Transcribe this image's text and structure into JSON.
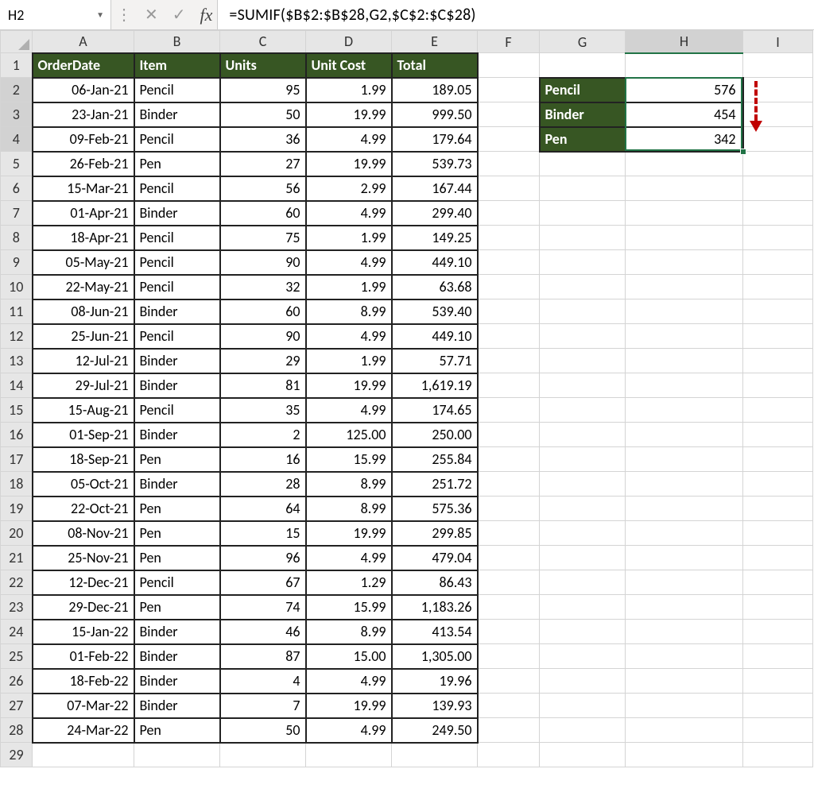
{
  "formula_bar": {
    "name_box": "H2",
    "fx_label": "fx",
    "formula": "=SUMIF($B$2:$B$28,G2,$C$2:$C$28)"
  },
  "columns": [
    "A",
    "B",
    "C",
    "D",
    "E",
    "F",
    "G",
    "H",
    "I"
  ],
  "row_headers": [
    "1",
    "2",
    "3",
    "4",
    "5",
    "6",
    "7",
    "8",
    "9",
    "10",
    "11",
    "12",
    "13",
    "14",
    "15",
    "16",
    "17",
    "18",
    "19",
    "20",
    "21",
    "22",
    "23",
    "24",
    "25",
    "26",
    "27",
    "28",
    "29"
  ],
  "main_table": {
    "headers": {
      "A": "OrderDate",
      "B": "Item",
      "C": "Units",
      "D": "Unit Cost",
      "E": "Total"
    },
    "rows": [
      {
        "A": "06-Jan-21",
        "B": "Pencil",
        "C": "95",
        "D": "1.99",
        "E": "189.05"
      },
      {
        "A": "23-Jan-21",
        "B": "Binder",
        "C": "50",
        "D": "19.99",
        "E": "999.50"
      },
      {
        "A": "09-Feb-21",
        "B": "Pencil",
        "C": "36",
        "D": "4.99",
        "E": "179.64"
      },
      {
        "A": "26-Feb-21",
        "B": "Pen",
        "C": "27",
        "D": "19.99",
        "E": "539.73"
      },
      {
        "A": "15-Mar-21",
        "B": "Pencil",
        "C": "56",
        "D": "2.99",
        "E": "167.44"
      },
      {
        "A": "01-Apr-21",
        "B": "Binder",
        "C": "60",
        "D": "4.99",
        "E": "299.40"
      },
      {
        "A": "18-Apr-21",
        "B": "Pencil",
        "C": "75",
        "D": "1.99",
        "E": "149.25"
      },
      {
        "A": "05-May-21",
        "B": "Pencil",
        "C": "90",
        "D": "4.99",
        "E": "449.10"
      },
      {
        "A": "22-May-21",
        "B": "Pencil",
        "C": "32",
        "D": "1.99",
        "E": "63.68"
      },
      {
        "A": "08-Jun-21",
        "B": "Binder",
        "C": "60",
        "D": "8.99",
        "E": "539.40"
      },
      {
        "A": "25-Jun-21",
        "B": "Pencil",
        "C": "90",
        "D": "4.99",
        "E": "449.10"
      },
      {
        "A": "12-Jul-21",
        "B": "Binder",
        "C": "29",
        "D": "1.99",
        "E": "57.71"
      },
      {
        "A": "29-Jul-21",
        "B": "Binder",
        "C": "81",
        "D": "19.99",
        "E": "1,619.19"
      },
      {
        "A": "15-Aug-21",
        "B": "Pencil",
        "C": "35",
        "D": "4.99",
        "E": "174.65"
      },
      {
        "A": "01-Sep-21",
        "B": "Binder",
        "C": "2",
        "D": "125.00",
        "E": "250.00"
      },
      {
        "A": "18-Sep-21",
        "B": "Pen",
        "C": "16",
        "D": "15.99",
        "E": "255.84"
      },
      {
        "A": "05-Oct-21",
        "B": "Binder",
        "C": "28",
        "D": "8.99",
        "E": "251.72"
      },
      {
        "A": "22-Oct-21",
        "B": "Pen",
        "C": "64",
        "D": "8.99",
        "E": "575.36"
      },
      {
        "A": "08-Nov-21",
        "B": "Pen",
        "C": "15",
        "D": "19.99",
        "E": "299.85"
      },
      {
        "A": "25-Nov-21",
        "B": "Pen",
        "C": "96",
        "D": "4.99",
        "E": "479.04"
      },
      {
        "A": "12-Dec-21",
        "B": "Pencil",
        "C": "67",
        "D": "1.29",
        "E": "86.43"
      },
      {
        "A": "29-Dec-21",
        "B": "Pen",
        "C": "74",
        "D": "15.99",
        "E": "1,183.26"
      },
      {
        "A": "15-Jan-22",
        "B": "Binder",
        "C": "46",
        "D": "8.99",
        "E": "413.54"
      },
      {
        "A": "01-Feb-22",
        "B": "Binder",
        "C": "87",
        "D": "15.00",
        "E": "1,305.00"
      },
      {
        "A": "18-Feb-22",
        "B": "Binder",
        "C": "4",
        "D": "4.99",
        "E": "19.96"
      },
      {
        "A": "07-Mar-22",
        "B": "Binder",
        "C": "7",
        "D": "19.99",
        "E": "139.93"
      },
      {
        "A": "24-Mar-22",
        "B": "Pen",
        "C": "50",
        "D": "4.99",
        "E": "249.50"
      }
    ]
  },
  "summary": {
    "rows": [
      {
        "G": "Pencil",
        "H": "576"
      },
      {
        "G": "Binder",
        "H": "454"
      },
      {
        "G": "Pen",
        "H": "342"
      }
    ]
  },
  "selection": {
    "active_cell": "H2",
    "range": "H2:H4",
    "selected_column": "H"
  }
}
